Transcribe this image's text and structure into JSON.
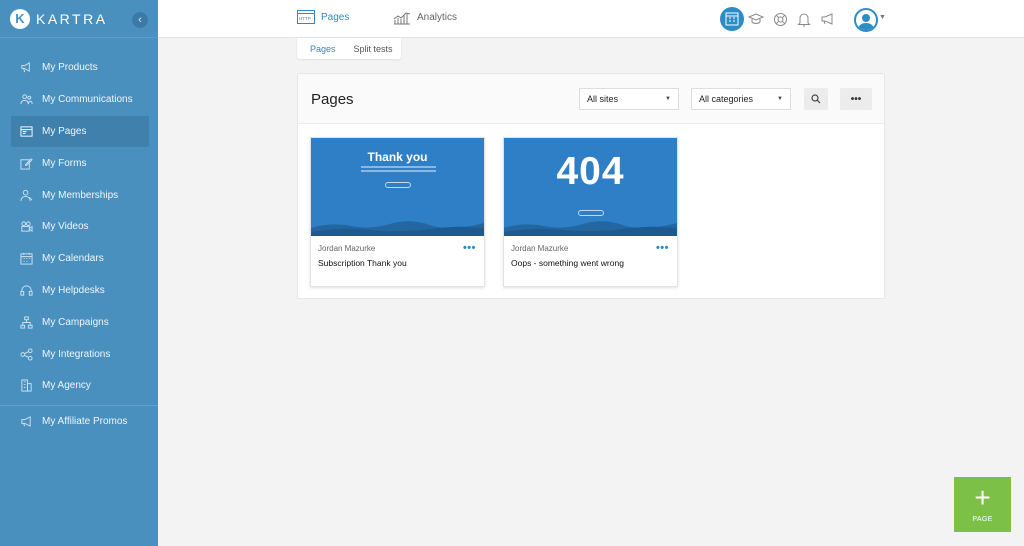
{
  "brand": {
    "name": "KARTRA",
    "logo_letter": "K"
  },
  "sidebar": {
    "items": [
      {
        "label": "My Products",
        "icon": "megaphone-cart-icon"
      },
      {
        "label": "My Communications",
        "icon": "people-icon"
      },
      {
        "label": "My Pages",
        "icon": "browser-icon",
        "active": true
      },
      {
        "label": "My Forms",
        "icon": "pencil-square-icon"
      },
      {
        "label": "My Memberships",
        "icon": "member-icon"
      },
      {
        "label": "My Videos",
        "icon": "video-icon"
      },
      {
        "label": "My Calendars",
        "icon": "calendar-icon"
      },
      {
        "label": "My Helpdesks",
        "icon": "headset-icon"
      },
      {
        "label": "My Campaigns",
        "icon": "sitemap-icon"
      },
      {
        "label": "My Integrations",
        "icon": "share-icon"
      },
      {
        "label": "My Agency",
        "icon": "building-icon"
      },
      {
        "label": "My Affiliate Promos",
        "icon": "bullhorn-icon"
      }
    ]
  },
  "topbar": {
    "tabs": [
      {
        "label": "Pages",
        "icon": "http-page-icon",
        "active": true
      },
      {
        "label": "Analytics",
        "icon": "chart-icon"
      }
    ]
  },
  "subtabs": [
    {
      "label": "Pages",
      "active": true
    },
    {
      "label": "Split tests"
    }
  ],
  "panel": {
    "title": "Pages",
    "filters": {
      "sites": "All sites",
      "categories": "All categories"
    },
    "more_label": "•••"
  },
  "cards": [
    {
      "thumb_title": "Thank you",
      "author": "Jordan Mazurke",
      "title": "Subscription Thank you"
    },
    {
      "thumb_title": "404",
      "author": "Jordan Mazurke",
      "title": "Oops - something went wrong"
    }
  ],
  "fab": {
    "plus": "+",
    "label": "PAGE"
  },
  "colors": {
    "sidebar": "#4a90bf",
    "accent": "#2b8cc6",
    "fab": "#7dc048",
    "thumb": "#2f7fc6"
  }
}
